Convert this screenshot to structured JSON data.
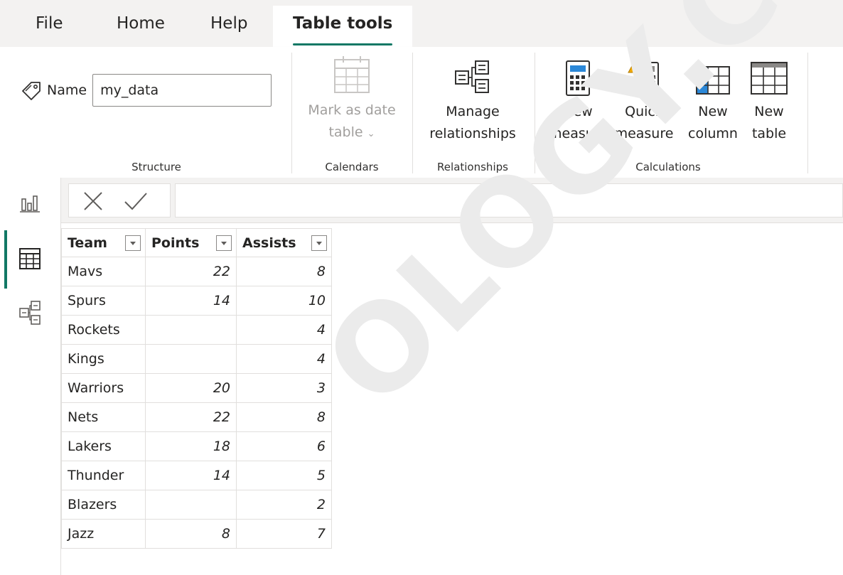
{
  "menu": {
    "file": "File",
    "home": "Home",
    "help": "Help",
    "table_tools": "Table tools"
  },
  "ribbon": {
    "structure": {
      "name_label": "Name",
      "name_value": "my_data",
      "group_label": "Structure"
    },
    "calendars": {
      "mark_date_line1": "Mark as date",
      "mark_date_line2": "table",
      "group_label": "Calendars"
    },
    "relationships": {
      "manage_line1": "Manage",
      "manage_line2": "relationships",
      "group_label": "Relationships"
    },
    "calculations": {
      "new_measure_line1": "New",
      "new_measure_line2": "measure",
      "quick_measure_line1": "Quick",
      "quick_measure_line2": "measure",
      "new_column_line1": "New",
      "new_column_line2": "column",
      "new_table_line1": "New",
      "new_table_line2": "table",
      "group_label": "Calculations"
    }
  },
  "table": {
    "headers": [
      "Team",
      "Points",
      "Assists"
    ],
    "rows": [
      [
        "Mavs",
        "22",
        "8"
      ],
      [
        "Spurs",
        "14",
        "10"
      ],
      [
        "Rockets",
        "",
        "4"
      ],
      [
        "Kings",
        "",
        "4"
      ],
      [
        "Warriors",
        "20",
        "3"
      ],
      [
        "Nets",
        "22",
        "8"
      ],
      [
        "Lakers",
        "18",
        "6"
      ],
      [
        "Thunder",
        "14",
        "5"
      ],
      [
        "Blazers",
        "",
        "2"
      ],
      [
        "Jazz",
        "8",
        "7"
      ]
    ]
  },
  "watermark": "OLOGY.COM",
  "colors": {
    "accent": "#117865",
    "menubar_bg": "#f3f2f1",
    "calc_blue": "#2b88d8",
    "quick_orange": "#f2a900"
  },
  "icons": {
    "name_tag": "tag-icon",
    "mark_date": "calendar-table-icon",
    "manage_rel": "relationships-icon",
    "new_measure": "calculator-icon",
    "quick_measure": "lightning-calculator-icon",
    "new_column": "column-table-icon",
    "new_table": "table-icon",
    "report_view": "bar-chart-icon",
    "data_view": "table-grid-icon",
    "model_view": "model-icon",
    "cancel": "close-icon",
    "commit": "check-icon"
  }
}
